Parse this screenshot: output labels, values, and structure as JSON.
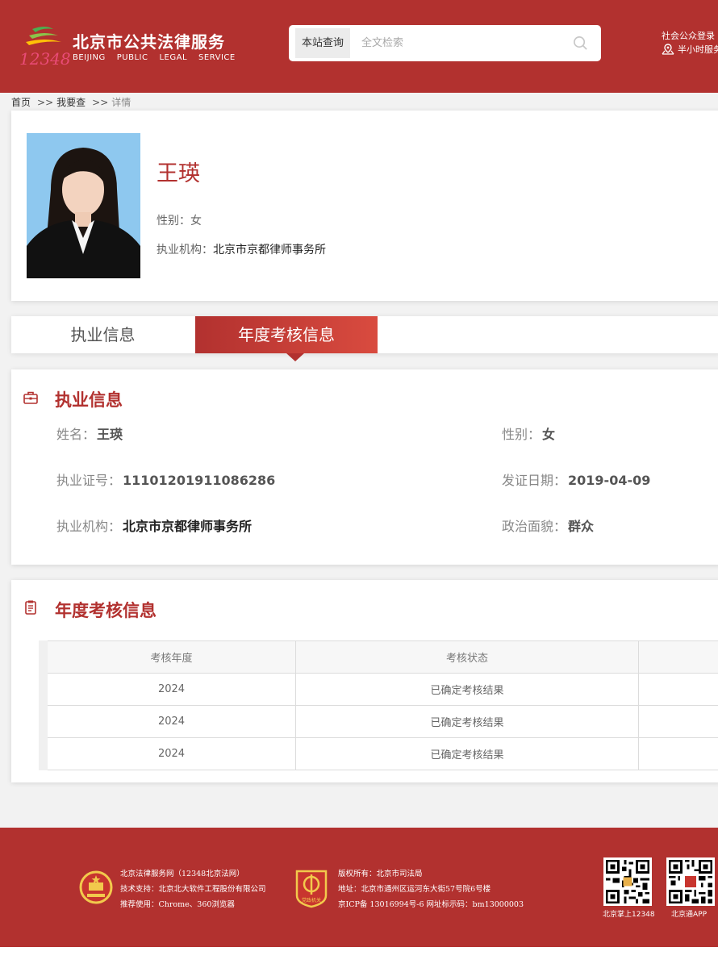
{
  "header": {
    "logo_cn": "北京市公共法律服务",
    "logo_en": [
      "BEIJING",
      "PUBLIC",
      "LEGAL",
      "SERVICE"
    ],
    "logo_num": "12348",
    "search_scope": "本站查询",
    "search_placeholder": "全文检索",
    "login_link": "社会公众登录",
    "service_link": "半小时服务",
    "brand_color": "#b2312f"
  },
  "breadcrumb": {
    "home": "首页",
    "sep": ">>",
    "level2": "我要查",
    "current": "详情"
  },
  "profile": {
    "name": "王瑛",
    "gender_label": "性别：",
    "gender": "女",
    "org_label": "执业机构：",
    "org": "北京市京都律师事务所"
  },
  "tabs": [
    {
      "label": "执业信息",
      "active": false
    },
    {
      "label": "年度考核信息",
      "active": true
    }
  ],
  "practice": {
    "title": "执业信息",
    "name_label": "姓名：",
    "name": "王瑛",
    "gender_label": "性别：",
    "gender": "女",
    "cert_label": "执业证号：",
    "cert_no": "11101201911086286",
    "issue_label": "发证日期：",
    "issue_date": "2019-04-09",
    "org_label": "执业机构：",
    "org": "北京市京都律师事务所",
    "political_label": "政治面貌：",
    "political": "群众"
  },
  "annual": {
    "title": "年度考核信息",
    "columns": [
      "考核年度",
      "考核状态"
    ],
    "rows": [
      [
        "2024",
        "已确定考核结果"
      ],
      [
        "2024",
        "已确定考核结果"
      ],
      [
        "2024",
        "已确定考核结果"
      ]
    ]
  },
  "footer": {
    "col1": [
      "北京法律服务网（12348北京法网）",
      "技术支持：北京北大软件工程股份有限公司",
      "推荐使用：Chrome、360浏览器"
    ],
    "col2": [
      "版权所有：北京市司法局",
      "地址：北京市通州区运河东大街57号院6号楼",
      "京ICP备 13016994号-6 网址标示码：bm13000003"
    ],
    "badge_text": "党政机关",
    "qr1_label": "北京掌上12348",
    "qr2_label": "北京通APP"
  }
}
